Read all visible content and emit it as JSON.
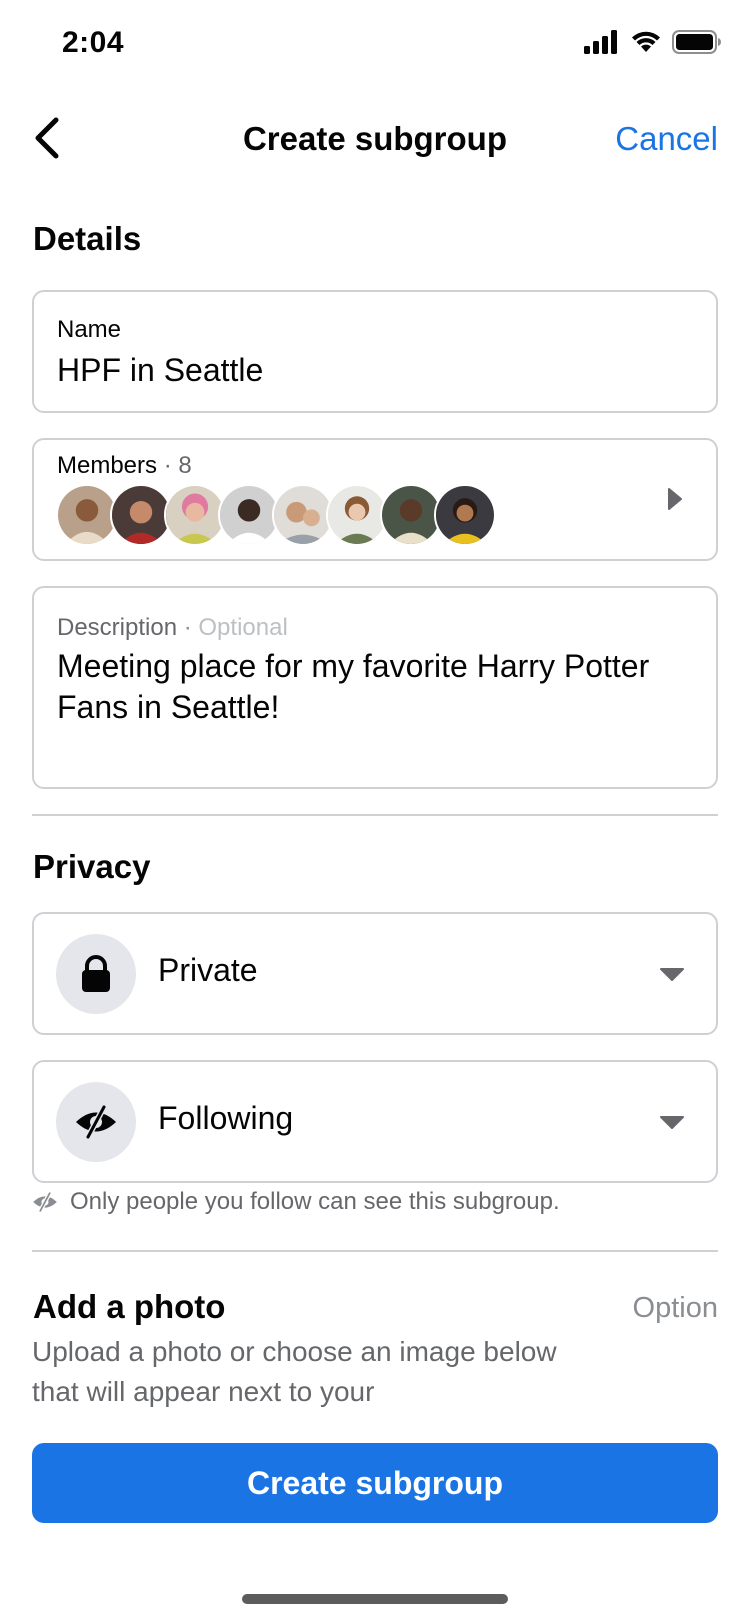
{
  "status": {
    "time": "2:04"
  },
  "nav": {
    "title": "Create subgroup",
    "cancel": "Cancel"
  },
  "details": {
    "heading": "Details",
    "name_label": "Name",
    "name_value": "HPF in Seattle",
    "members_label": "Members",
    "members_sep": "·",
    "members_count": "8",
    "description_label": "Description",
    "description_sep": "·",
    "description_optional": "Optional",
    "description_value": "Meeting place for my favorite Harry Potter Fans in Seattle!"
  },
  "privacy": {
    "heading": "Privacy",
    "visibility_value": "Private",
    "audience_value": "Following",
    "hint": "Only people you follow can see this subgroup."
  },
  "photo": {
    "heading": "Add a photo",
    "optional": "Option",
    "body": "Upload a photo or choose an image below that will appear next to your"
  },
  "primary_button": "Create subgroup",
  "colors": {
    "accent": "#1b74e4",
    "border": "#ced0d4",
    "icon_bg": "#e4e6eb"
  },
  "icons": [
    "back-chevron-icon",
    "signal-icon",
    "wifi-icon",
    "battery-icon",
    "chevron-right-icon",
    "lock-icon",
    "eye-slash-icon",
    "caret-down-icon"
  ]
}
